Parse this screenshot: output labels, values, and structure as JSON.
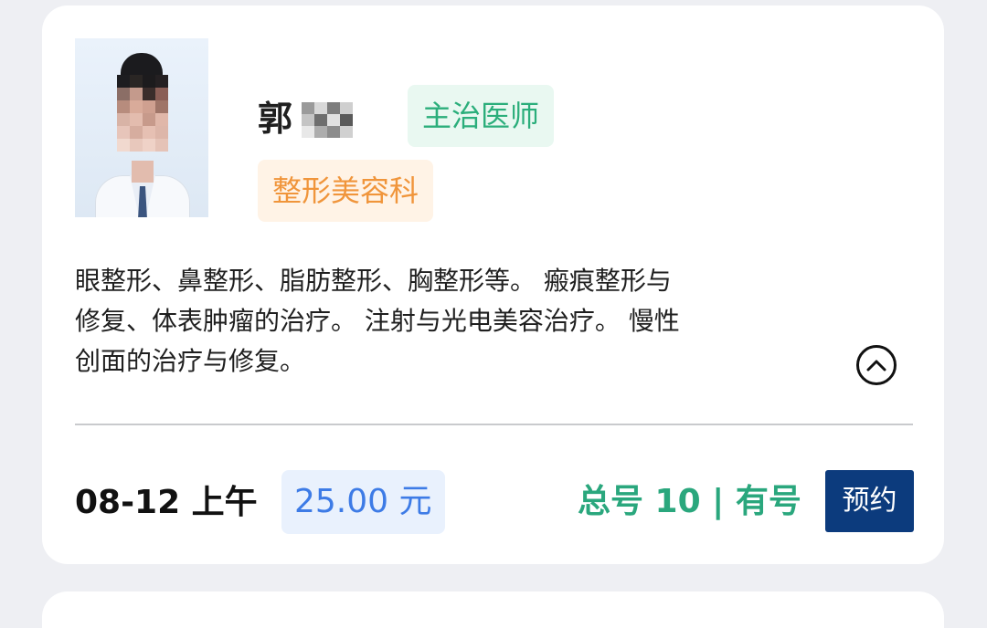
{
  "doctor": {
    "name_visible": "郭",
    "title_tag": "主治医师",
    "department_tag": "整形美容科",
    "description_lines": [
      "眼整形、鼻整形、脂肪整形、胸整形等。 瘢痕整形与",
      "修复、体表肿瘤的治疗。 注射与光电美容治疗。 慢性",
      "创面的治疗与修复。"
    ]
  },
  "schedule": {
    "date_session": "08-12 上午",
    "price": "25.00 元",
    "quota": "总号 10 | 有号",
    "book_label": "预约"
  },
  "icons": {
    "collapse": "chevron-up-circle-icon"
  },
  "colors": {
    "title_tag_text": "#2bae7b",
    "title_tag_bg": "#e9f8f1",
    "department_tag_text": "#f0953b",
    "department_tag_bg": "#fff3e6",
    "price_text": "#3d7be6",
    "price_bg": "#e9f1fd",
    "quota_text": "#2aa77d",
    "book_button_bg": "#0c3b7d"
  }
}
